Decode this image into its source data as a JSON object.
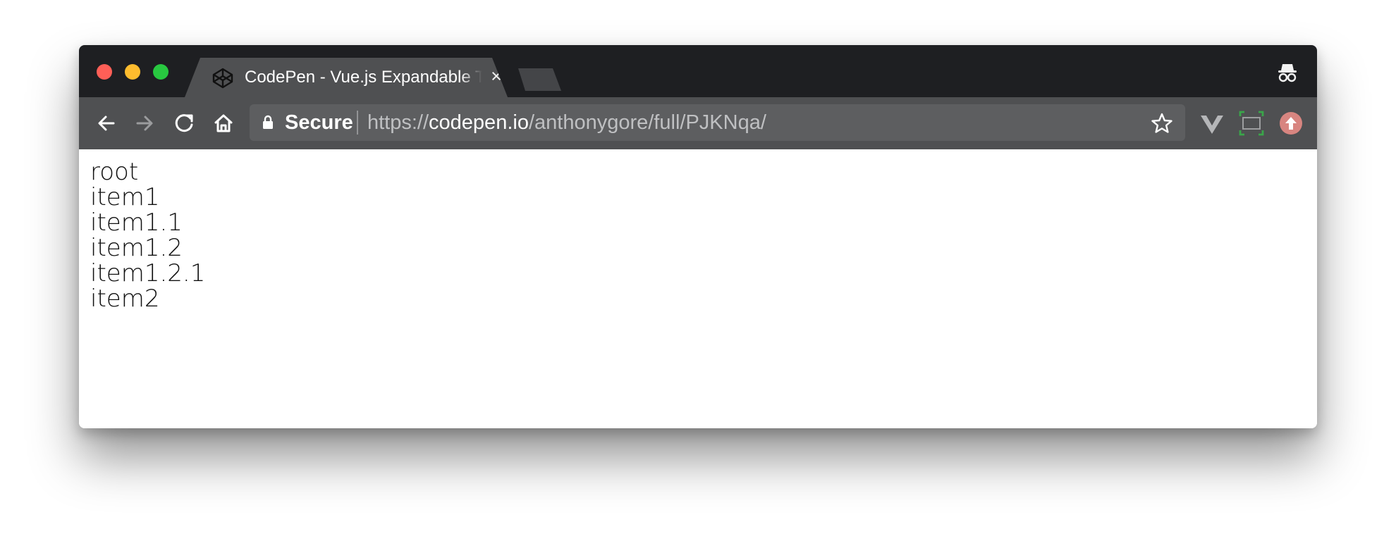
{
  "browser": {
    "tab": {
      "title": "CodePen - Vue.js Expandable Tree",
      "close_symbol": "×",
      "icon": "codepen-icon"
    },
    "address_bar": {
      "security_label": "Secure",
      "url_scheme": "https://",
      "url_host": "codepen.io",
      "url_path": "/anthonygore/full/PJKNqa/"
    },
    "icons": {
      "back": "back-arrow-icon",
      "forward": "forward-arrow-icon",
      "reload": "reload-icon",
      "home": "home-icon",
      "lock": "lock-icon",
      "bookmark": "star-icon",
      "incognito": "incognito-icon",
      "vue_extension": "vue-devtools-icon",
      "screenshot_extension": "screenshot-frame-icon",
      "upload_extension": "upload-icon"
    },
    "colors": {
      "titlebar": "#1e1f22",
      "toolbar": "#4f5052",
      "omnibox": "#5d5e60",
      "close_dot": "#fe5f57",
      "minimize_dot": "#febc2e",
      "maximize_dot": "#28c840",
      "upload_extension": "#d88580"
    }
  },
  "page": {
    "tree_items": [
      "root",
      "item1",
      "item1.1",
      "item1.2",
      "item1.2.1",
      "item2"
    ]
  }
}
